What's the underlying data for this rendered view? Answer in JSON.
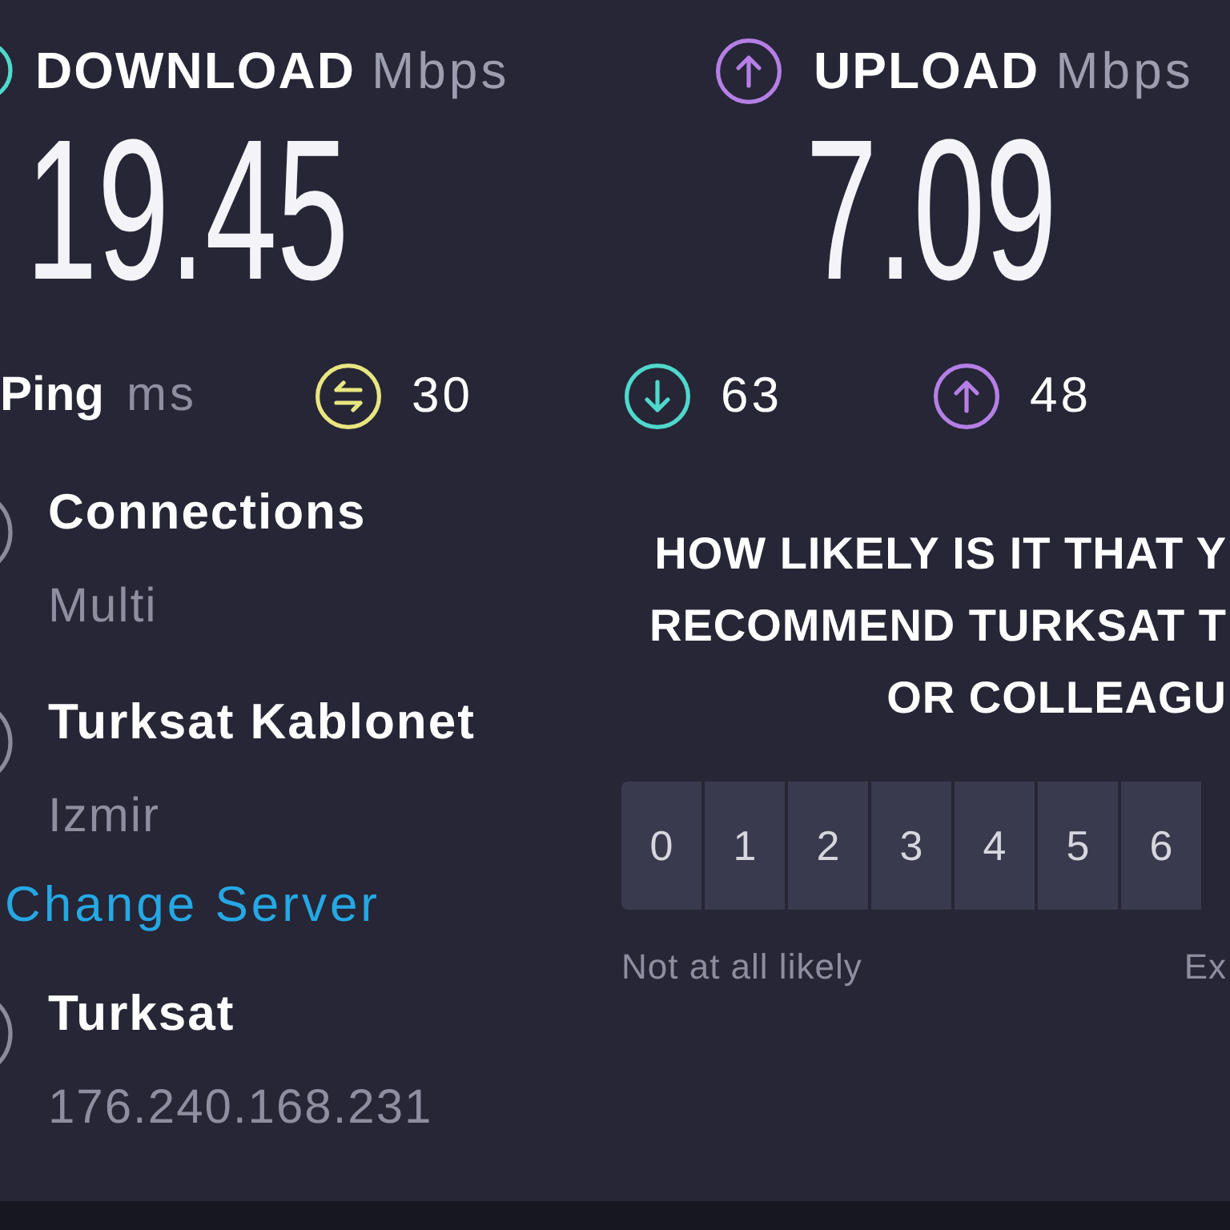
{
  "results": [
    {
      "kind": "download",
      "label": "DOWNLOAD",
      "unit": "Mbps",
      "value": "19.45"
    },
    {
      "kind": "upload",
      "label": "UPLOAD",
      "unit": "Mbps",
      "value": "7.09"
    }
  ],
  "latency": {
    "label": "Ping",
    "unit": "ms",
    "items": [
      {
        "kind": "ping",
        "value": "30"
      },
      {
        "kind": "download",
        "value": "63"
      },
      {
        "kind": "upload",
        "value": "48"
      }
    ]
  },
  "details": [
    {
      "title": "Connections",
      "subtitle": "Multi"
    },
    {
      "title": "Turksat Kablonet",
      "subtitle": "Izmir",
      "link": "Change Server"
    },
    {
      "title": "Turksat",
      "subtitle": "176.240.168.231"
    }
  ],
  "survey": {
    "question_lines": [
      "HOW LIKELY IS IT THAT Y",
      "RECOMMEND TURKSAT T",
      "OR COLLEAGU"
    ],
    "options": [
      {
        "label": "0",
        "selected": false
      },
      {
        "label": "1",
        "selected": false
      },
      {
        "label": "2",
        "selected": false
      },
      {
        "label": "3",
        "selected": false
      },
      {
        "label": "4",
        "selected": false
      },
      {
        "label": "5",
        "selected": false
      },
      {
        "label": "6",
        "selected": false
      }
    ],
    "low_label": "Not at all likely",
    "high_label": "Ex"
  }
}
